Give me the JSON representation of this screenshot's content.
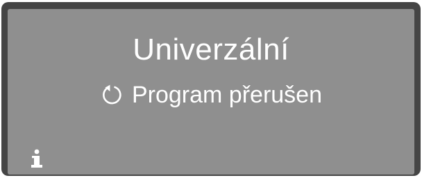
{
  "display": {
    "program_name": "Univerzální",
    "status_icon": "restart-circular-arrow-icon",
    "status_text": "Program přerušen",
    "info_icon": "info-icon"
  },
  "colors": {
    "bezel": "#454545",
    "screen": "#8f8f8f",
    "text": "#ffffff"
  }
}
